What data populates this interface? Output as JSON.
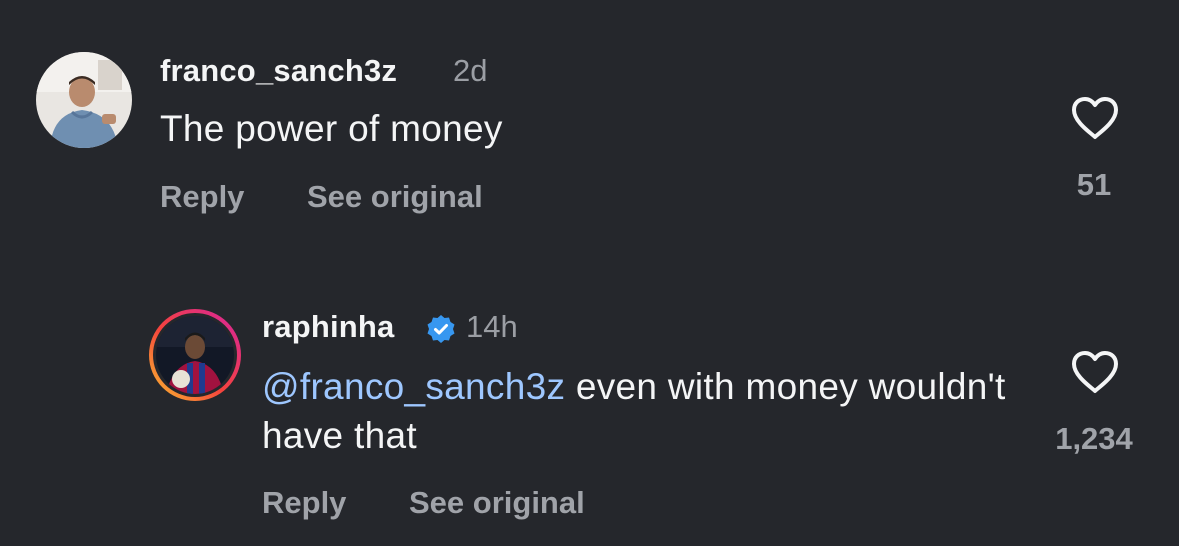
{
  "comments": [
    {
      "username": "franco_sanch3z",
      "time": "2d",
      "text": "The power of money",
      "reply_label": "Reply",
      "see_original_label": "See original",
      "like_count": "51"
    },
    {
      "username": "raphinha",
      "verified": true,
      "time": "14h",
      "mention": "@franco_sanch3z",
      "text": " even with money wouldn't have that",
      "reply_label": "Reply",
      "see_original_label": "See original",
      "like_count": "1,234"
    }
  ],
  "colors": {
    "background": "#25272c",
    "mention": "#9ec7ff",
    "verified": "#3797f0"
  },
  "icons": [
    "avatar",
    "heart-icon",
    "verified-badge-icon"
  ]
}
